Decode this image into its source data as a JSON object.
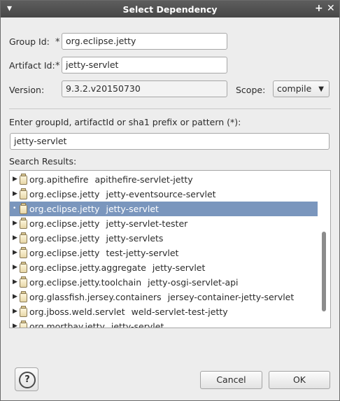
{
  "window": {
    "title": "Select Dependency"
  },
  "form": {
    "group_label": "Group Id:",
    "group_value": "org.eclipse.jetty",
    "artifact_label": "Artifact Id:",
    "artifact_value": "jetty-servlet",
    "version_label": "Version:",
    "version_value": "9.3.2.v20150730",
    "scope_label": "Scope:",
    "scope_value": "compile",
    "required_marker": "*"
  },
  "search": {
    "prompt": "Enter groupId, artifactId or sha1 prefix or pattern (*):",
    "value": "jetty-servlet",
    "results_label": "Search Results:"
  },
  "results": [
    {
      "group": "org.apithefire",
      "artifact": "apithefire-servlet-jetty"
    },
    {
      "group": "org.eclipse.jetty",
      "artifact": "jetty-eventsource-servlet"
    },
    {
      "group": "org.eclipse.jetty",
      "artifact": "jetty-servlet",
      "selected": true
    },
    {
      "group": "org.eclipse.jetty",
      "artifact": "jetty-servlet-tester"
    },
    {
      "group": "org.eclipse.jetty",
      "artifact": "jetty-servlets"
    },
    {
      "group": "org.eclipse.jetty",
      "artifact": "test-jetty-servlet"
    },
    {
      "group": "org.eclipse.jetty.aggregate",
      "artifact": "jetty-servlet"
    },
    {
      "group": "org.eclipse.jetty.toolchain",
      "artifact": "jetty-osgi-servlet-api"
    },
    {
      "group": "org.glassfish.jersey.containers",
      "artifact": "jersey-container-jetty-servlet"
    },
    {
      "group": "org.jboss.weld.servlet",
      "artifact": "weld-servlet-test-jetty"
    },
    {
      "group": "org.mortbay.jetty",
      "artifact": "jetty-servlet"
    }
  ],
  "buttons": {
    "help": "?",
    "cancel": "Cancel",
    "ok": "OK"
  },
  "icons": {
    "expand": "triangle-right-icon",
    "jar": "jar-icon",
    "close": "close-icon"
  }
}
